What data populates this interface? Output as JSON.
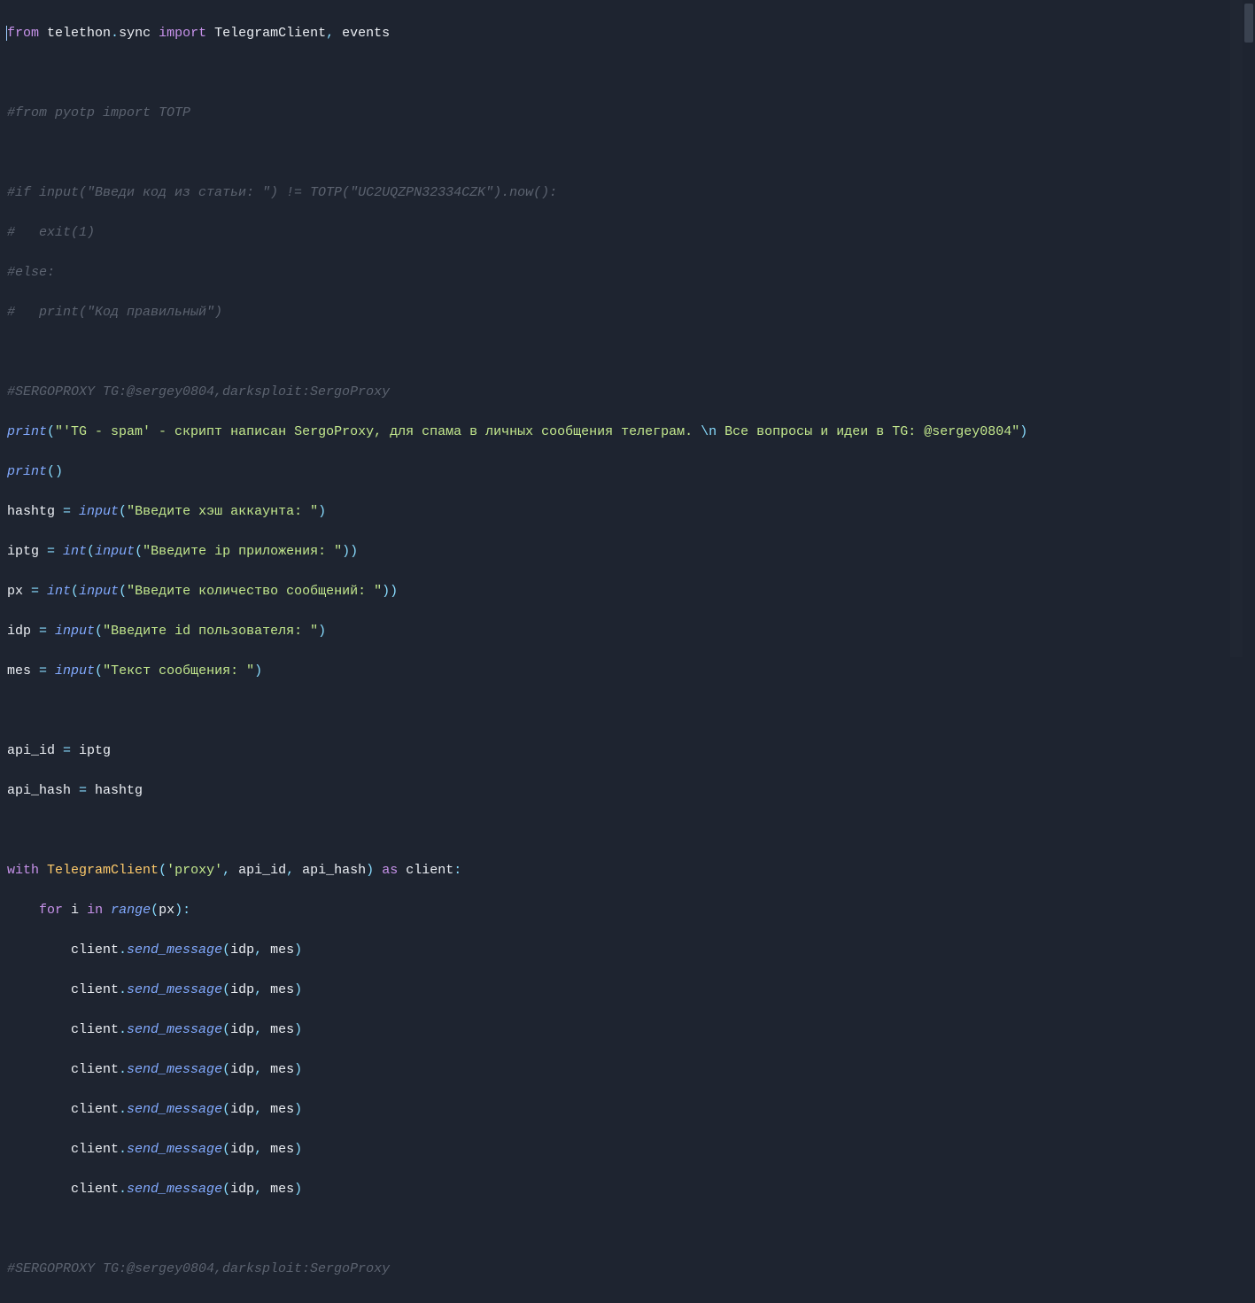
{
  "tokens": {
    "kw_from": "from",
    "kw_import": "import",
    "kw_with": "with",
    "kw_as": "as",
    "kw_for": "for",
    "kw_in": "in",
    "mod_telethon": "telethon",
    "mod_sync": "sync",
    "cls_TelegramClient": "TelegramClient",
    "cls_events": "events",
    "fn_print": "print",
    "fn_input": "input",
    "fn_int": "int",
    "fn_range": "range",
    "fn_send_message": "send_message",
    "id_hashtg": "hashtg",
    "id_iptg": "iptg",
    "id_px": "px",
    "id_idp": "idp",
    "id_mes": "mes",
    "id_api_id": "api_id",
    "id_api_hash": "api_hash",
    "id_client": "client",
    "id_i": "i"
  },
  "strings": {
    "big_print_a": "\"'TG - spam' - скрипт написан SergoProxy, для спама в личных сообщения телеграм. ",
    "big_print_esc": "\\n",
    "big_print_b": " Все вопросы и идеи в TG: @sergey0804\"",
    "s_hash": "\"Введите хэш аккаунта: \"",
    "s_ip": "\"Введите ip приложения: \"",
    "s_count": "\"Введите количество сообщений: \"",
    "s_iduser": "\"Введите id пользователя: \"",
    "s_text": "\"Текст сообщения: \"",
    "s_proxy": "'proxy'"
  },
  "comments": {
    "c1": "#from pyotp import TOTP",
    "c2": "#if input(\"Введи код из статьи: \") != TOTP(\"UC2UQZPN32334CZK\").now():",
    "c3": "#   exit(1)",
    "c4": "#else:",
    "c5": "#   print(\"Код правильный\")",
    "c6": "#SERGOPROXY TG:@sergey0804,darksploit:SergoProxy",
    "c7": "#SERGOPROXY TG:@sergey0804,darksploit:SergoProxy"
  },
  "punct": {
    "dot": ".",
    "comma": ", ",
    "lparen": "(",
    "rparen": ")",
    "colon": ":",
    "eq": " = ",
    "sp": " "
  }
}
